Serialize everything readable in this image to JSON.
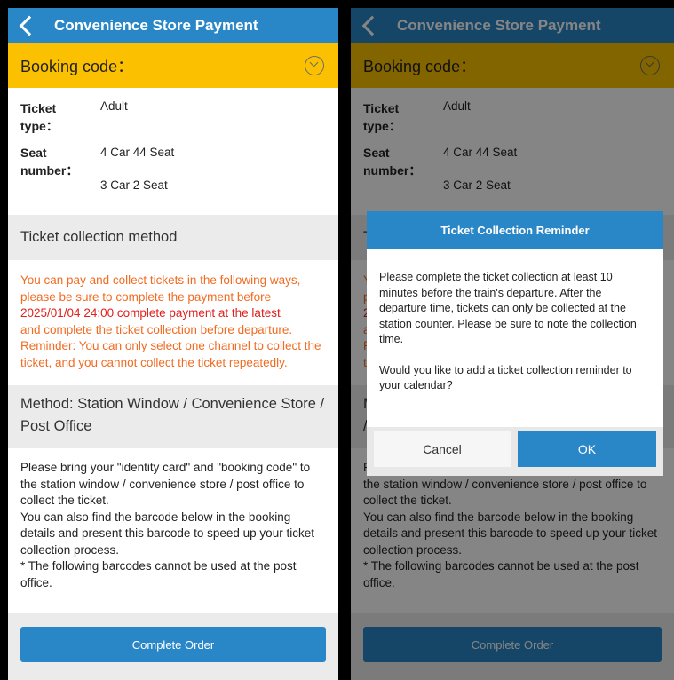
{
  "header": {
    "title": "Convenience Store Payment"
  },
  "booking": {
    "label": "Booking code："
  },
  "ticket": {
    "type_label": "Ticket type：",
    "type_value": "Adult",
    "seat_label": "Seat number：",
    "seats": [
      "4 Car 44 Seat",
      "3 Car 2 Seat"
    ]
  },
  "collection": {
    "heading": "Ticket collection method",
    "notice_1": "You can pay and collect tickets in the following ways, please be sure to complete the payment before",
    "notice_deadline": "2025/01/04 24:00 complete payment at the latest",
    "notice_2": "and complete the ticket collection before departure. Reminder: You can only select one channel to collect the ticket, and you cannot collect the ticket repeatedly."
  },
  "method": {
    "heading": "Method: Station Window / Convenience Store / Post Office",
    "desc": [
      "Please bring your \"identity card\" and \"booking code\" to the station window / convenience store / post office to collect the ticket.",
      "You can also find the barcode below in the booking details and present this barcode to speed up your ticket collection process.",
      "* The following barcodes cannot be used at the post office."
    ]
  },
  "footer": {
    "complete_label": "Complete Order"
  },
  "dialog": {
    "title": "Ticket Collection Reminder",
    "body_1": "Please complete the ticket collection at least 10 minutes before the train's departure. After the departure time, tickets can only be collected at the station counter. Please be sure to note the collection time.",
    "body_2": "Would you like to add a ticket collection reminder to your calendar?",
    "cancel": "Cancel",
    "ok": "OK"
  },
  "colors": {
    "primary": "#2a87c7",
    "booking_bar": "#fbc100",
    "notice": "#f26b22",
    "deadline": "#e0201c"
  }
}
